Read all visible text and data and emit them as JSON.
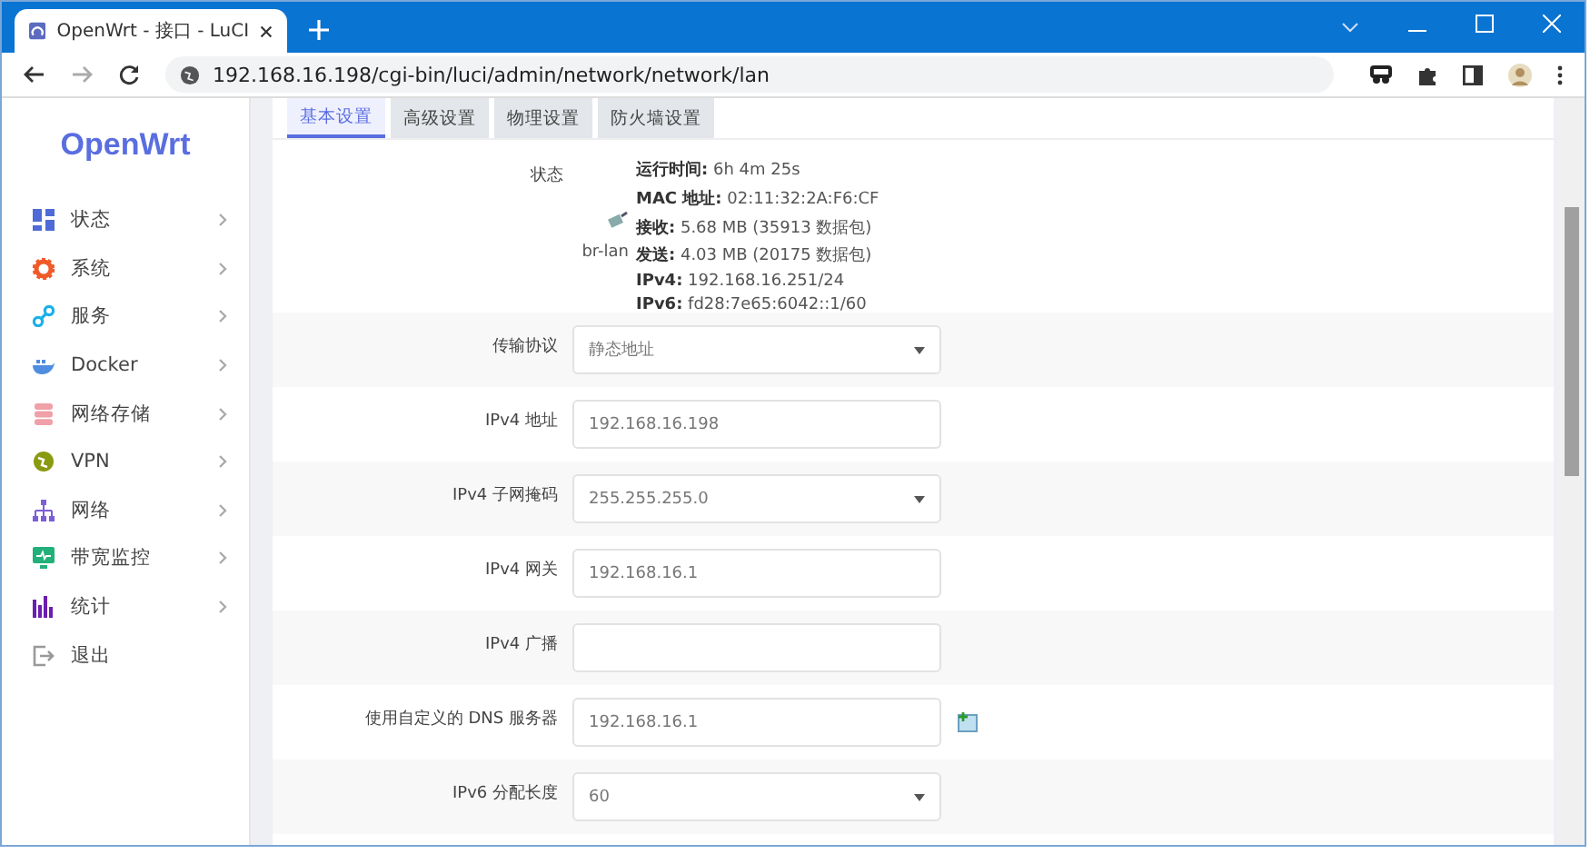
{
  "browser": {
    "tab_title": "OpenWrt - 接口 - LuCI",
    "url": "192.168.16.198/cgi-bin/luci/admin/network/network/lan"
  },
  "sidebar": {
    "logo": "OpenWrt",
    "items": [
      {
        "label": "状态",
        "expandable": true
      },
      {
        "label": "系统",
        "expandable": true
      },
      {
        "label": "服务",
        "expandable": true
      },
      {
        "label": "Docker",
        "expandable": true
      },
      {
        "label": "网络存储",
        "expandable": true
      },
      {
        "label": "VPN",
        "expandable": true
      },
      {
        "label": "网络",
        "expandable": true
      },
      {
        "label": "带宽监控",
        "expandable": true
      },
      {
        "label": "统计",
        "expandable": true
      },
      {
        "label": "退出",
        "expandable": false
      }
    ]
  },
  "tabs": [
    {
      "label": "基本设置",
      "selected": true
    },
    {
      "label": "高级设置",
      "selected": false
    },
    {
      "label": "物理设置",
      "selected": false
    },
    {
      "label": "防火墙设置",
      "selected": false
    }
  ],
  "status": {
    "label": "状态",
    "device": "br-lan",
    "lines": [
      "**运行时间:** 6h 4m 25s",
      "**MAC 地址:** 02:11:32:2A:F6:CF",
      "**接收:** 5.68 MB (35913 数据包)",
      "**发送:** 4.03 MB (20175 数据包)",
      "**IPv4:** 192.168.16.251/24",
      "**IPv6:** fd28:7e65:6042::1/60"
    ]
  },
  "fields": [
    {
      "label": "传输协议",
      "kind": "select",
      "value": "静态地址"
    },
    {
      "label": "IPv4 地址",
      "kind": "text",
      "value": "192.168.16.198"
    },
    {
      "label": "IPv4 子网掩码",
      "kind": "select",
      "value": "255.255.255.0"
    },
    {
      "label": "IPv4 网关",
      "kind": "text",
      "value": "192.168.16.1"
    },
    {
      "label": "IPv4 广播",
      "kind": "text"
    },
    {
      "label": "使用自定义的 DNS 服务器",
      "kind": "list",
      "value": "192.168.16.1"
    },
    {
      "label": "IPv6 分配长度",
      "kind": "select",
      "value": "60"
    }
  ]
}
